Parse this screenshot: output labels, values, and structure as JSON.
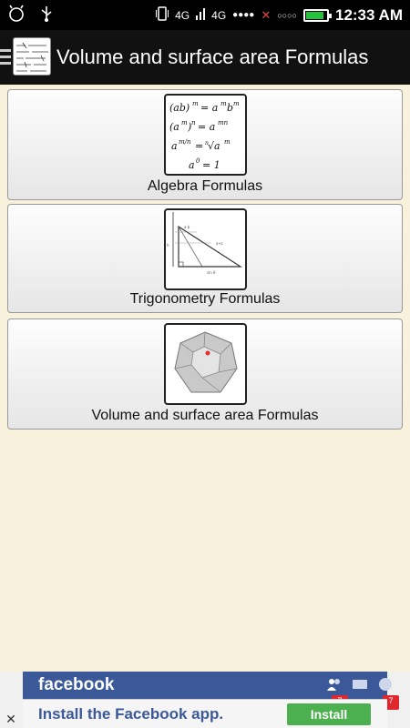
{
  "status_bar": {
    "network1": "4G",
    "network2": "4G",
    "signal_dots": "●●●●",
    "no_signal": "✕",
    "empty_dots": "○○○○",
    "time": "12:33 AM",
    "battery_level": 0.85,
    "battery_color": "#22c33a"
  },
  "app_bar": {
    "title": "Volume and surface area Formulas"
  },
  "cards": [
    {
      "label": "Algebra Formulas",
      "icon": "algebra-formulas-icon"
    },
    {
      "label": "Trigonometry Formulas",
      "icon": "triangle-diagram-icon"
    },
    {
      "label": "Volume and surface area Formulas",
      "icon": "dodecahedron-icon"
    }
  ],
  "ad": {
    "brand": "facebook",
    "message": "Install the Facebook app.",
    "button": "Install",
    "close": "✕",
    "badge1": "7",
    "badge2": "7",
    "brand_color": "#3b5998",
    "button_color": "#4caf50"
  }
}
